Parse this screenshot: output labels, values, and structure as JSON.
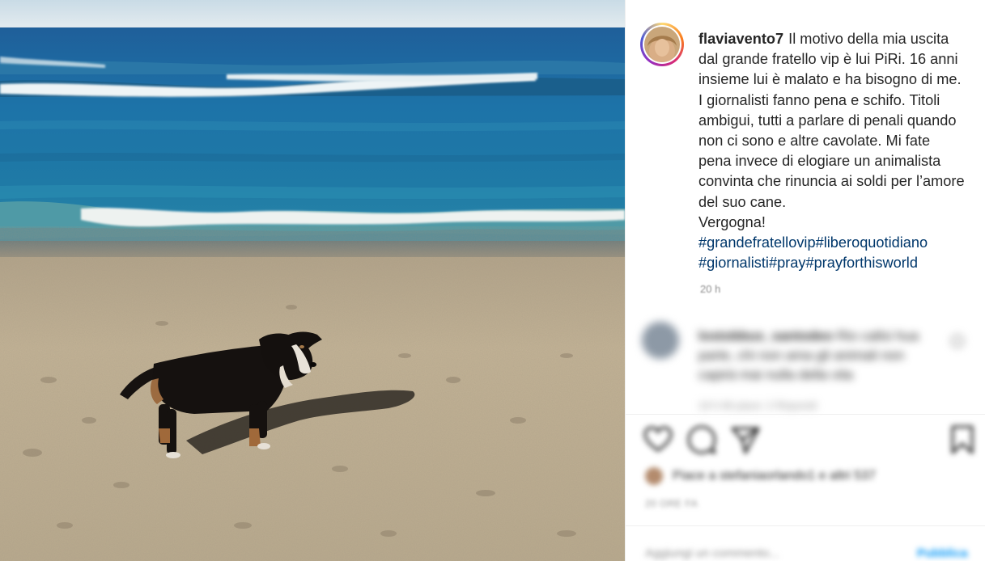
{
  "post": {
    "username": "flaviavento7",
    "caption_lines": [
      "Il motivo della mia uscita",
      "dal grande fratello vip è lui PiRi. 16",
      "anni insieme lui è malato e ha bisogno",
      "di me. I giornalisti fanno pena e schifo.",
      "Titoli ambigui, tutti a parlare di penali",
      "quando non ci sono e altre cavolate.",
      "Mi fate pena invece di elogiare un",
      "animalista convinta che rinuncia ai",
      "soldi per l’amore del suo cane.",
      "Vergogna!"
    ],
    "hashtags": [
      "#grandefratellovip",
      "#liberoquotidiano",
      "#giornalisti",
      "#pray",
      "#prayforthisworld"
    ],
    "time_ago": "20 h"
  },
  "comment": {
    "user": "lostobbus_santodeo",
    "text": "Rio callsi hua parte, chi non ama gli animali non capirà mai nulla della vita",
    "meta": "19 h   Mi piace: 2   Rispondi"
  },
  "actions": {
    "like_icon": "heart-icon",
    "comment_icon": "comment-bubble-icon",
    "share_icon": "paper-plane-icon",
    "save_icon": "bookmark-icon"
  },
  "likes_text": "Piace a stefaniaorlando1 e altri 537",
  "date_text": "20 ORE FA",
  "add_comment": {
    "placeholder": "Aggiungi un commento...",
    "post_label": "Pubblica"
  },
  "colors": {
    "hashtag": "#00376b",
    "link_blue": "#0095f6",
    "muted": "#8e8e8e",
    "text": "#262626"
  }
}
